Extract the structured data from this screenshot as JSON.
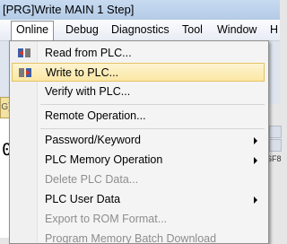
{
  "window": {
    "title": "[PRG]Write MAIN 1 Step]"
  },
  "menubar": {
    "items": [
      {
        "label": "Online"
      },
      {
        "label": "Debug"
      },
      {
        "label": "Diagnostics"
      },
      {
        "label": "Tool"
      },
      {
        "label": "Window"
      },
      {
        "label": "H"
      }
    ]
  },
  "background": {
    "left_tab_label": "G]V",
    "left_value": "0",
    "right_label": "SF8"
  },
  "dropdown": {
    "items": [
      {
        "label": "Read from PLC...",
        "enabled": true
      },
      {
        "label": "Write to PLC...",
        "enabled": true,
        "highlighted": true
      },
      {
        "label": "Verify with PLC...",
        "enabled": true
      },
      {
        "label": "Remote Operation...",
        "enabled": true
      },
      {
        "label": "Password/Keyword",
        "enabled": true,
        "submenu": true
      },
      {
        "label": "PLC Memory Operation",
        "enabled": true,
        "submenu": true
      },
      {
        "label": "Delete PLC Data...",
        "enabled": false
      },
      {
        "label": "PLC User Data",
        "enabled": true,
        "submenu": true
      },
      {
        "label": "Export to ROM Format...",
        "enabled": false
      },
      {
        "label": "Program Memory Batch Download",
        "enabled": false
      }
    ]
  }
}
